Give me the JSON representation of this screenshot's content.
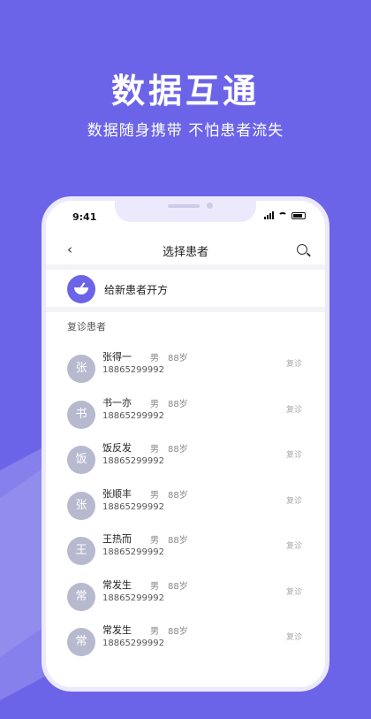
{
  "promo": {
    "headline": "数据互通",
    "subline": "数据随身携带 不怕患者流失"
  },
  "status": {
    "time": "9:41"
  },
  "nav": {
    "back": "‹",
    "title": "选择患者"
  },
  "new_patient": {
    "label": "给新患者开方"
  },
  "section": {
    "label": "复诊患者"
  },
  "patients": [
    {
      "avatar": "张",
      "name": "张得一",
      "sex": "男",
      "age": "88岁",
      "phone": "18865299992",
      "tag": "复诊"
    },
    {
      "avatar": "书",
      "name": "书一亦",
      "sex": "男",
      "age": "88岁",
      "phone": "18865299992",
      "tag": "复诊"
    },
    {
      "avatar": "饭",
      "name": "饭反发",
      "sex": "男",
      "age": "88岁",
      "phone": "18865299992",
      "tag": "复诊"
    },
    {
      "avatar": "张",
      "name": "张顺丰",
      "sex": "男",
      "age": "88岁",
      "phone": "18865299992",
      "tag": "复诊"
    },
    {
      "avatar": "王",
      "name": "王热而",
      "sex": "男",
      "age": "88岁",
      "phone": "18865299992",
      "tag": "复诊"
    },
    {
      "avatar": "常",
      "name": "常发生",
      "sex": "男",
      "age": "88岁",
      "phone": "18865299992",
      "tag": "复诊"
    },
    {
      "avatar": "常",
      "name": "常发生",
      "sex": "男",
      "age": "88岁",
      "phone": "18865299992",
      "tag": "复诊"
    }
  ]
}
